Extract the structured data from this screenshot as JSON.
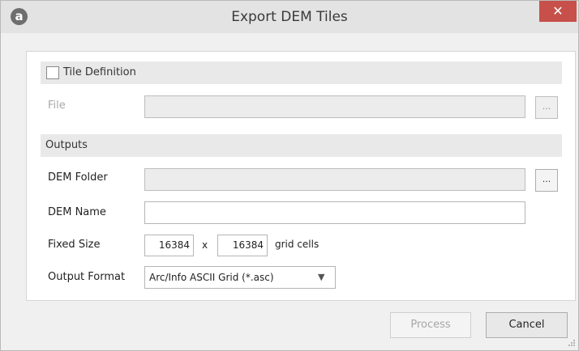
{
  "window": {
    "title": "Export DEM Tiles",
    "app_icon_glyph": "a",
    "close_glyph": "✕"
  },
  "tile_definition": {
    "label": "Tile Definition",
    "checked": false,
    "file_label": "File",
    "file_value": "",
    "browse_label": "..."
  },
  "outputs": {
    "section_label": "Outputs",
    "dem_folder_label": "DEM Folder",
    "dem_folder_value": "",
    "browse_label": "...",
    "dem_name_label": "DEM Name",
    "dem_name_value": "",
    "fixed_size_label": "Fixed Size",
    "size_x": "16384",
    "size_separator": "x",
    "size_y": "16384",
    "size_unit": "grid cells",
    "output_format_label": "Output Format",
    "output_format_value": "Arc/Info ASCII Grid (*.asc)"
  },
  "buttons": {
    "process_label": "Process",
    "cancel_label": "Cancel"
  },
  "colors": {
    "close_button": "#c7504a",
    "titlebar": "#e3e3e3",
    "section_bar": "#e9e9e9"
  }
}
